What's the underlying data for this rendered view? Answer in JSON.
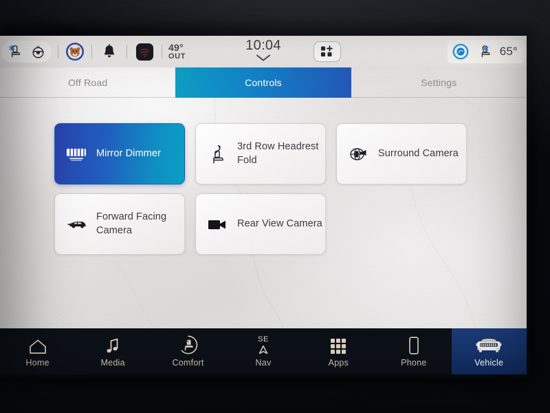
{
  "status_bar": {
    "left_icons": [
      {
        "name": "cooled-seat-icon",
        "label": "Cooled Seat"
      },
      {
        "name": "heated-steering-wheel-icon",
        "label": "Heated Steering Wheel"
      }
    ],
    "profile_icon": "user-profile-avatar-icon",
    "notification_icon": "bell-icon",
    "wifi_icon": "wifi-icon",
    "outside_temp": "49°",
    "outside_label": "OUT",
    "clock": "10:04",
    "clock_chevron": "chevron-down-icon",
    "add_widget_icon": "grid-plus-icon",
    "assistant_icon": "assistant-circle-icon",
    "cabin_seat_icon": "cooled-seat-icon",
    "cabin_temp": "65°",
    "accent_blue": "#1a8fd6",
    "accent_teal": "#0e9fc4"
  },
  "tabs": [
    {
      "label": "Off Road",
      "active": false
    },
    {
      "label": "Controls",
      "active": true
    },
    {
      "label": "Settings",
      "active": false
    }
  ],
  "tiles": [
    {
      "label": "Mirror Dimmer",
      "icon": "mirror-dimmer-icon",
      "active": true
    },
    {
      "label": "3rd Row Headrest Fold",
      "icon": "headrest-fold-icon",
      "active": false
    },
    {
      "label": "Surround Camera",
      "icon": "surround-camera-icon",
      "active": false
    },
    {
      "label": "Forward Facing Camera",
      "icon": "forward-facing-camera-icon",
      "active": false
    },
    {
      "label": "Rear View Camera",
      "icon": "rear-view-camera-icon",
      "active": false
    }
  ],
  "bottom_nav": [
    {
      "label": "Home",
      "icon": "home-icon",
      "active": false
    },
    {
      "label": "Media",
      "icon": "music-note-icon",
      "active": false
    },
    {
      "label": "Comfort",
      "icon": "comfort-seat-icon",
      "active": false
    },
    {
      "label": "Nav",
      "icon": "compass-icon",
      "active": false,
      "direction": "SE"
    },
    {
      "label": "Apps",
      "icon": "apps-grid-icon",
      "active": false
    },
    {
      "label": "Phone",
      "icon": "phone-icon",
      "active": false
    },
    {
      "label": "Vehicle",
      "icon": "vehicle-front-icon",
      "active": true
    }
  ]
}
